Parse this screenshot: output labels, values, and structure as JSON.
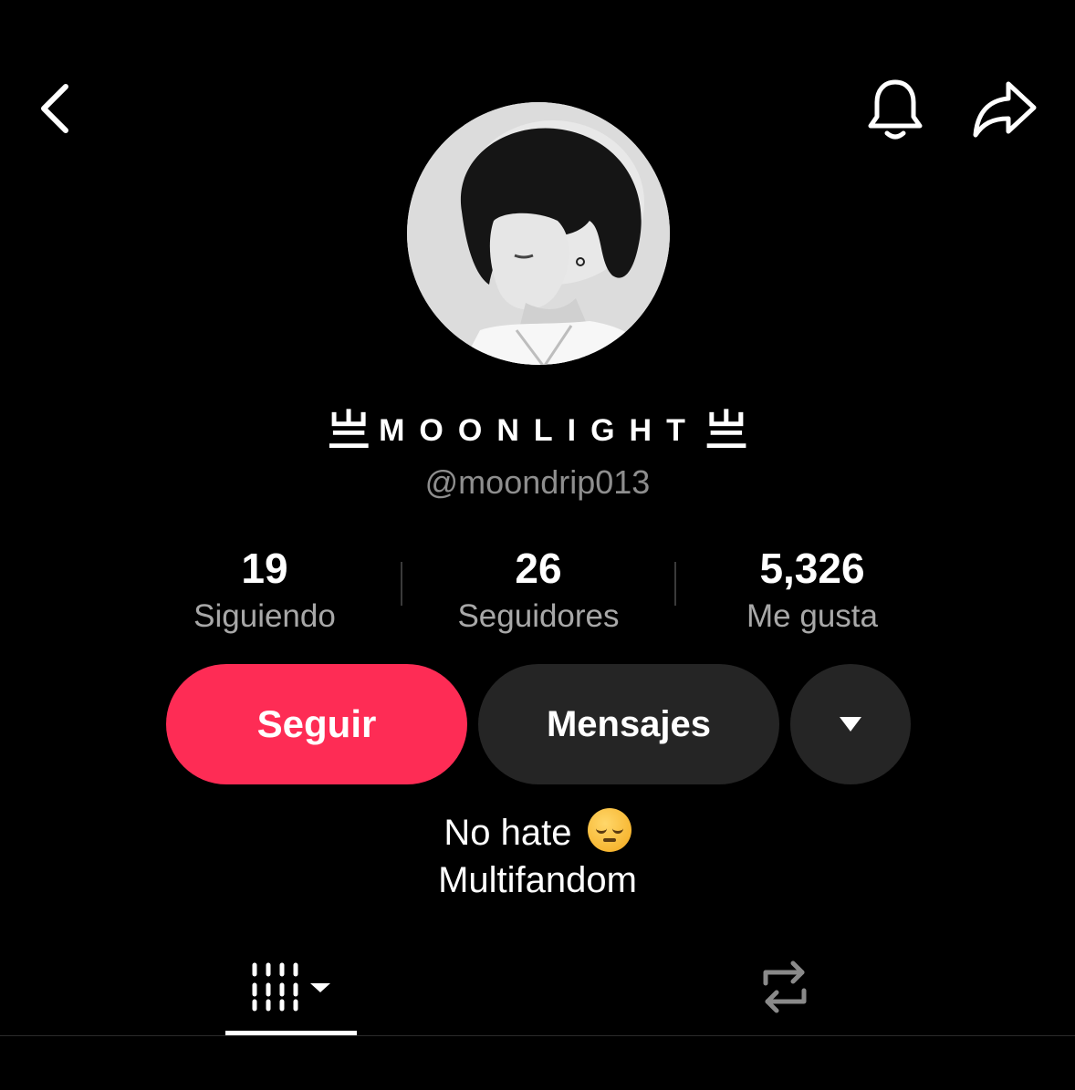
{
  "header": {
    "back_icon": "chevron-left-icon",
    "bell_icon": "bell-icon",
    "share_icon": "share-arrow-icon"
  },
  "profile": {
    "avatar_alt": "profile-photo",
    "display_name_prefix": "亗",
    "display_name": "MOONLIGHT",
    "display_name_suffix": "亗",
    "handle": "@moondrip013"
  },
  "stats": [
    {
      "value": "19",
      "label": "Siguiendo"
    },
    {
      "value": "26",
      "label": "Seguidores"
    },
    {
      "value": "5,326",
      "label": "Me gusta"
    }
  ],
  "actions": {
    "follow_label": "Seguir",
    "messages_label": "Mensajes",
    "more_icon": "caret-down-icon"
  },
  "bio": {
    "line1": "No hate",
    "emoji": "pensive-face-emoji",
    "line2": "Multifandom"
  },
  "tabs": [
    {
      "icon": "videos-grid-icon",
      "active": true
    },
    {
      "icon": "repost-icon",
      "active": false
    }
  ],
  "colors": {
    "background": "#000000",
    "accent": "#fe2c55",
    "secondary_button": "#252525",
    "muted_text": "#8e8e8e"
  }
}
